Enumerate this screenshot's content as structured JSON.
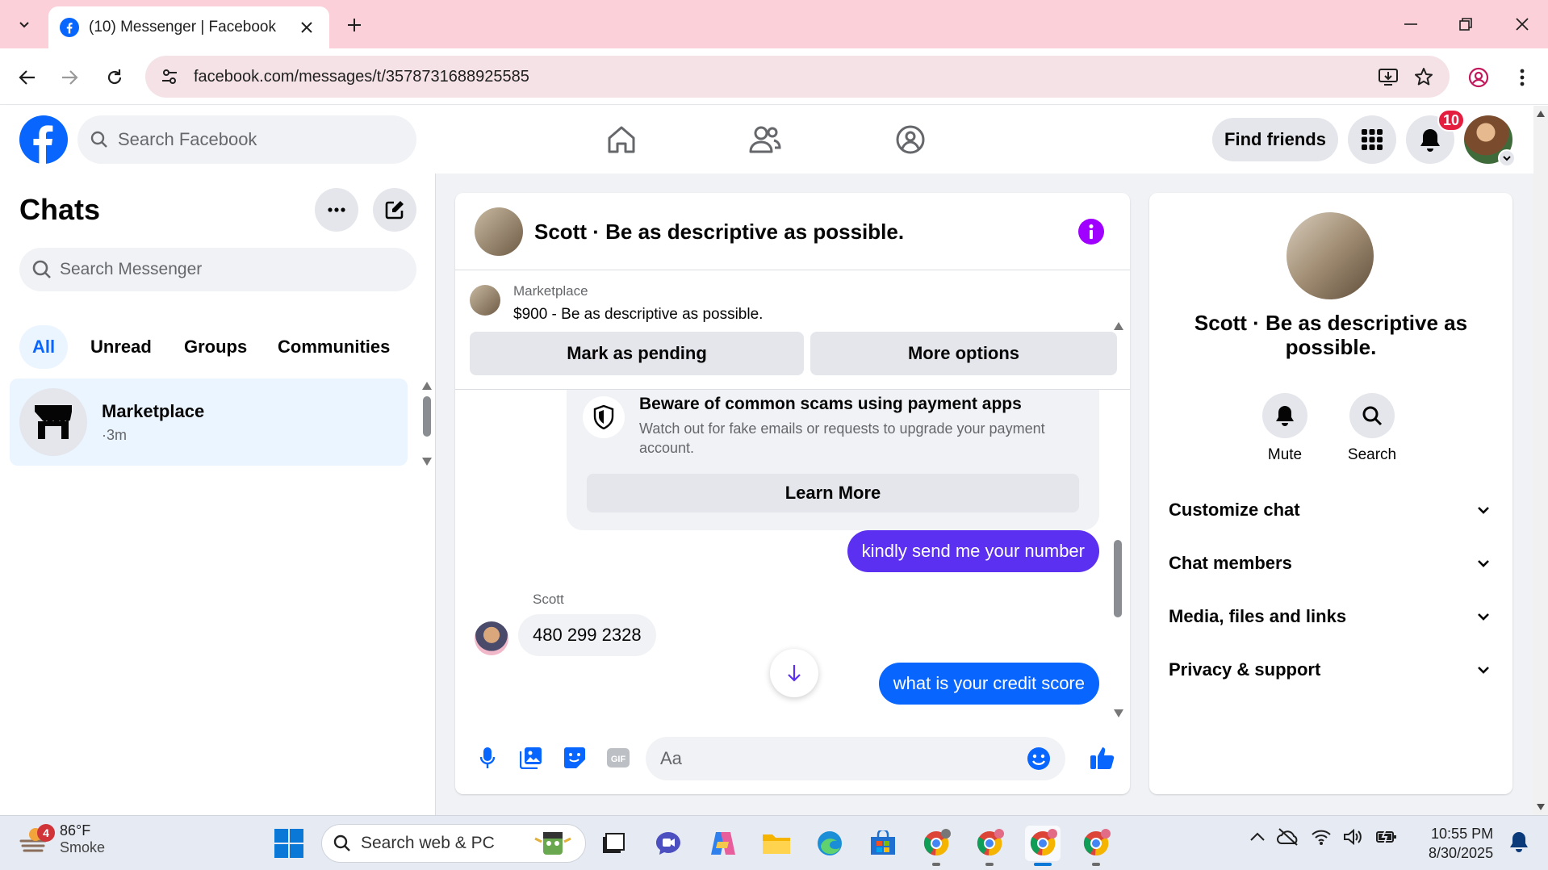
{
  "browser": {
    "tab_title": "(10) Messenger | Facebook",
    "url": "facebook.com/messages/t/3578731688925585"
  },
  "fb_header": {
    "search_placeholder": "Search Facebook",
    "find_friends_label": "Find friends",
    "notification_count": "10"
  },
  "chats": {
    "title": "Chats",
    "search_placeholder": "Search Messenger",
    "filters": [
      "All",
      "Unread",
      "Groups",
      "Communities"
    ],
    "active_filter": "All",
    "items": [
      {
        "name": "Marketplace",
        "time": "·3m"
      }
    ]
  },
  "conversation": {
    "title": "Scott · Be as descriptive as possible.",
    "listing": {
      "label": "Marketplace",
      "price_title": "$900 - Be as descriptive as possible.",
      "mark_pending_label": "Mark as pending",
      "more_options_label": "More options"
    },
    "scam_notice": {
      "title": "Beware of common scams using payment apps",
      "description": "Watch out for fake emails or requests to upgrade your payment account.",
      "button_label": "Learn More"
    },
    "messages": [
      {
        "from": "me",
        "text": "kindly send me your number",
        "color": "#5b30f0"
      },
      {
        "from": "Scott",
        "sender_label": "Scott",
        "text": "480 299 2328"
      },
      {
        "from": "me",
        "text": "what is your credit score",
        "color": "#0866ff"
      }
    ],
    "composer_placeholder": "Aa"
  },
  "details_panel": {
    "name": "Scott · Be as descriptive as possible.",
    "actions": [
      {
        "label": "Mute",
        "icon": "bell-icon"
      },
      {
        "label": "Search",
        "icon": "search-icon"
      }
    ],
    "sections": [
      "Customize chat",
      "Chat members",
      "Media, files and links",
      "Privacy & support"
    ]
  },
  "taskbar": {
    "weather_temp": "86°F",
    "weather_condition": "Smoke",
    "weather_badge": "4",
    "search_placeholder": "Search web & PC",
    "time": "10:55 PM",
    "date": "8/30/2025"
  },
  "colors": {
    "fb_blue": "#0866ff",
    "tab_strip": "#fbd0d9",
    "outgoing_purple": "#5b30f0",
    "info_purple": "#a000ff",
    "notif_red": "#e41e3f"
  }
}
